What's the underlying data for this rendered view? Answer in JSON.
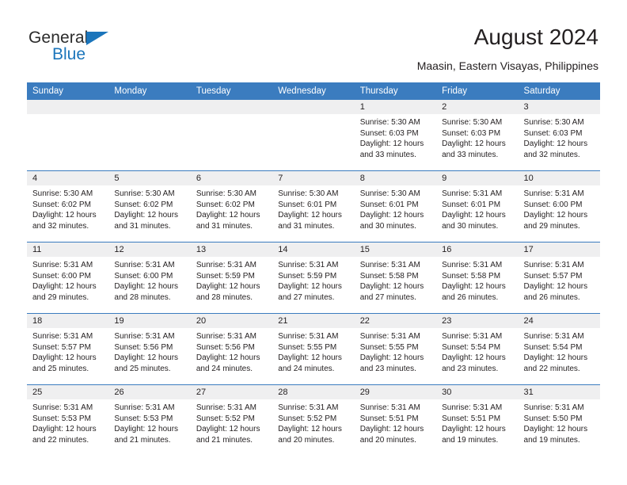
{
  "brand": {
    "name_part1": "General",
    "name_part2": "Blue",
    "accent_color": "#1b75bb"
  },
  "header": {
    "title": "August 2024",
    "subtitle": "Maasin, Eastern Visayas, Philippines"
  },
  "calendar": {
    "header_color": "#3b7cbf",
    "daynum_band_color": "#efeff0",
    "weekday_headers": [
      "Sunday",
      "Monday",
      "Tuesday",
      "Wednesday",
      "Thursday",
      "Friday",
      "Saturday"
    ],
    "weeks": [
      [
        {
          "day": "",
          "sunrise": "",
          "sunset": "",
          "daylight1": "",
          "daylight2": ""
        },
        {
          "day": "",
          "sunrise": "",
          "sunset": "",
          "daylight1": "",
          "daylight2": ""
        },
        {
          "day": "",
          "sunrise": "",
          "sunset": "",
          "daylight1": "",
          "daylight2": ""
        },
        {
          "day": "",
          "sunrise": "",
          "sunset": "",
          "daylight1": "",
          "daylight2": ""
        },
        {
          "day": "1",
          "sunrise": "Sunrise: 5:30 AM",
          "sunset": "Sunset: 6:03 PM",
          "daylight1": "Daylight: 12 hours",
          "daylight2": "and 33 minutes."
        },
        {
          "day": "2",
          "sunrise": "Sunrise: 5:30 AM",
          "sunset": "Sunset: 6:03 PM",
          "daylight1": "Daylight: 12 hours",
          "daylight2": "and 33 minutes."
        },
        {
          "day": "3",
          "sunrise": "Sunrise: 5:30 AM",
          "sunset": "Sunset: 6:03 PM",
          "daylight1": "Daylight: 12 hours",
          "daylight2": "and 32 minutes."
        }
      ],
      [
        {
          "day": "4",
          "sunrise": "Sunrise: 5:30 AM",
          "sunset": "Sunset: 6:02 PM",
          "daylight1": "Daylight: 12 hours",
          "daylight2": "and 32 minutes."
        },
        {
          "day": "5",
          "sunrise": "Sunrise: 5:30 AM",
          "sunset": "Sunset: 6:02 PM",
          "daylight1": "Daylight: 12 hours",
          "daylight2": "and 31 minutes."
        },
        {
          "day": "6",
          "sunrise": "Sunrise: 5:30 AM",
          "sunset": "Sunset: 6:02 PM",
          "daylight1": "Daylight: 12 hours",
          "daylight2": "and 31 minutes."
        },
        {
          "day": "7",
          "sunrise": "Sunrise: 5:30 AM",
          "sunset": "Sunset: 6:01 PM",
          "daylight1": "Daylight: 12 hours",
          "daylight2": "and 31 minutes."
        },
        {
          "day": "8",
          "sunrise": "Sunrise: 5:30 AM",
          "sunset": "Sunset: 6:01 PM",
          "daylight1": "Daylight: 12 hours",
          "daylight2": "and 30 minutes."
        },
        {
          "day": "9",
          "sunrise": "Sunrise: 5:31 AM",
          "sunset": "Sunset: 6:01 PM",
          "daylight1": "Daylight: 12 hours",
          "daylight2": "and 30 minutes."
        },
        {
          "day": "10",
          "sunrise": "Sunrise: 5:31 AM",
          "sunset": "Sunset: 6:00 PM",
          "daylight1": "Daylight: 12 hours",
          "daylight2": "and 29 minutes."
        }
      ],
      [
        {
          "day": "11",
          "sunrise": "Sunrise: 5:31 AM",
          "sunset": "Sunset: 6:00 PM",
          "daylight1": "Daylight: 12 hours",
          "daylight2": "and 29 minutes."
        },
        {
          "day": "12",
          "sunrise": "Sunrise: 5:31 AM",
          "sunset": "Sunset: 6:00 PM",
          "daylight1": "Daylight: 12 hours",
          "daylight2": "and 28 minutes."
        },
        {
          "day": "13",
          "sunrise": "Sunrise: 5:31 AM",
          "sunset": "Sunset: 5:59 PM",
          "daylight1": "Daylight: 12 hours",
          "daylight2": "and 28 minutes."
        },
        {
          "day": "14",
          "sunrise": "Sunrise: 5:31 AM",
          "sunset": "Sunset: 5:59 PM",
          "daylight1": "Daylight: 12 hours",
          "daylight2": "and 27 minutes."
        },
        {
          "day": "15",
          "sunrise": "Sunrise: 5:31 AM",
          "sunset": "Sunset: 5:58 PM",
          "daylight1": "Daylight: 12 hours",
          "daylight2": "and 27 minutes."
        },
        {
          "day": "16",
          "sunrise": "Sunrise: 5:31 AM",
          "sunset": "Sunset: 5:58 PM",
          "daylight1": "Daylight: 12 hours",
          "daylight2": "and 26 minutes."
        },
        {
          "day": "17",
          "sunrise": "Sunrise: 5:31 AM",
          "sunset": "Sunset: 5:57 PM",
          "daylight1": "Daylight: 12 hours",
          "daylight2": "and 26 minutes."
        }
      ],
      [
        {
          "day": "18",
          "sunrise": "Sunrise: 5:31 AM",
          "sunset": "Sunset: 5:57 PM",
          "daylight1": "Daylight: 12 hours",
          "daylight2": "and 25 minutes."
        },
        {
          "day": "19",
          "sunrise": "Sunrise: 5:31 AM",
          "sunset": "Sunset: 5:56 PM",
          "daylight1": "Daylight: 12 hours",
          "daylight2": "and 25 minutes."
        },
        {
          "day": "20",
          "sunrise": "Sunrise: 5:31 AM",
          "sunset": "Sunset: 5:56 PM",
          "daylight1": "Daylight: 12 hours",
          "daylight2": "and 24 minutes."
        },
        {
          "day": "21",
          "sunrise": "Sunrise: 5:31 AM",
          "sunset": "Sunset: 5:55 PM",
          "daylight1": "Daylight: 12 hours",
          "daylight2": "and 24 minutes."
        },
        {
          "day": "22",
          "sunrise": "Sunrise: 5:31 AM",
          "sunset": "Sunset: 5:55 PM",
          "daylight1": "Daylight: 12 hours",
          "daylight2": "and 23 minutes."
        },
        {
          "day": "23",
          "sunrise": "Sunrise: 5:31 AM",
          "sunset": "Sunset: 5:54 PM",
          "daylight1": "Daylight: 12 hours",
          "daylight2": "and 23 minutes."
        },
        {
          "day": "24",
          "sunrise": "Sunrise: 5:31 AM",
          "sunset": "Sunset: 5:54 PM",
          "daylight1": "Daylight: 12 hours",
          "daylight2": "and 22 minutes."
        }
      ],
      [
        {
          "day": "25",
          "sunrise": "Sunrise: 5:31 AM",
          "sunset": "Sunset: 5:53 PM",
          "daylight1": "Daylight: 12 hours",
          "daylight2": "and 22 minutes."
        },
        {
          "day": "26",
          "sunrise": "Sunrise: 5:31 AM",
          "sunset": "Sunset: 5:53 PM",
          "daylight1": "Daylight: 12 hours",
          "daylight2": "and 21 minutes."
        },
        {
          "day": "27",
          "sunrise": "Sunrise: 5:31 AM",
          "sunset": "Sunset: 5:52 PM",
          "daylight1": "Daylight: 12 hours",
          "daylight2": "and 21 minutes."
        },
        {
          "day": "28",
          "sunrise": "Sunrise: 5:31 AM",
          "sunset": "Sunset: 5:52 PM",
          "daylight1": "Daylight: 12 hours",
          "daylight2": "and 20 minutes."
        },
        {
          "day": "29",
          "sunrise": "Sunrise: 5:31 AM",
          "sunset": "Sunset: 5:51 PM",
          "daylight1": "Daylight: 12 hours",
          "daylight2": "and 20 minutes."
        },
        {
          "day": "30",
          "sunrise": "Sunrise: 5:31 AM",
          "sunset": "Sunset: 5:51 PM",
          "daylight1": "Daylight: 12 hours",
          "daylight2": "and 19 minutes."
        },
        {
          "day": "31",
          "sunrise": "Sunrise: 5:31 AM",
          "sunset": "Sunset: 5:50 PM",
          "daylight1": "Daylight: 12 hours",
          "daylight2": "and 19 minutes."
        }
      ]
    ]
  }
}
